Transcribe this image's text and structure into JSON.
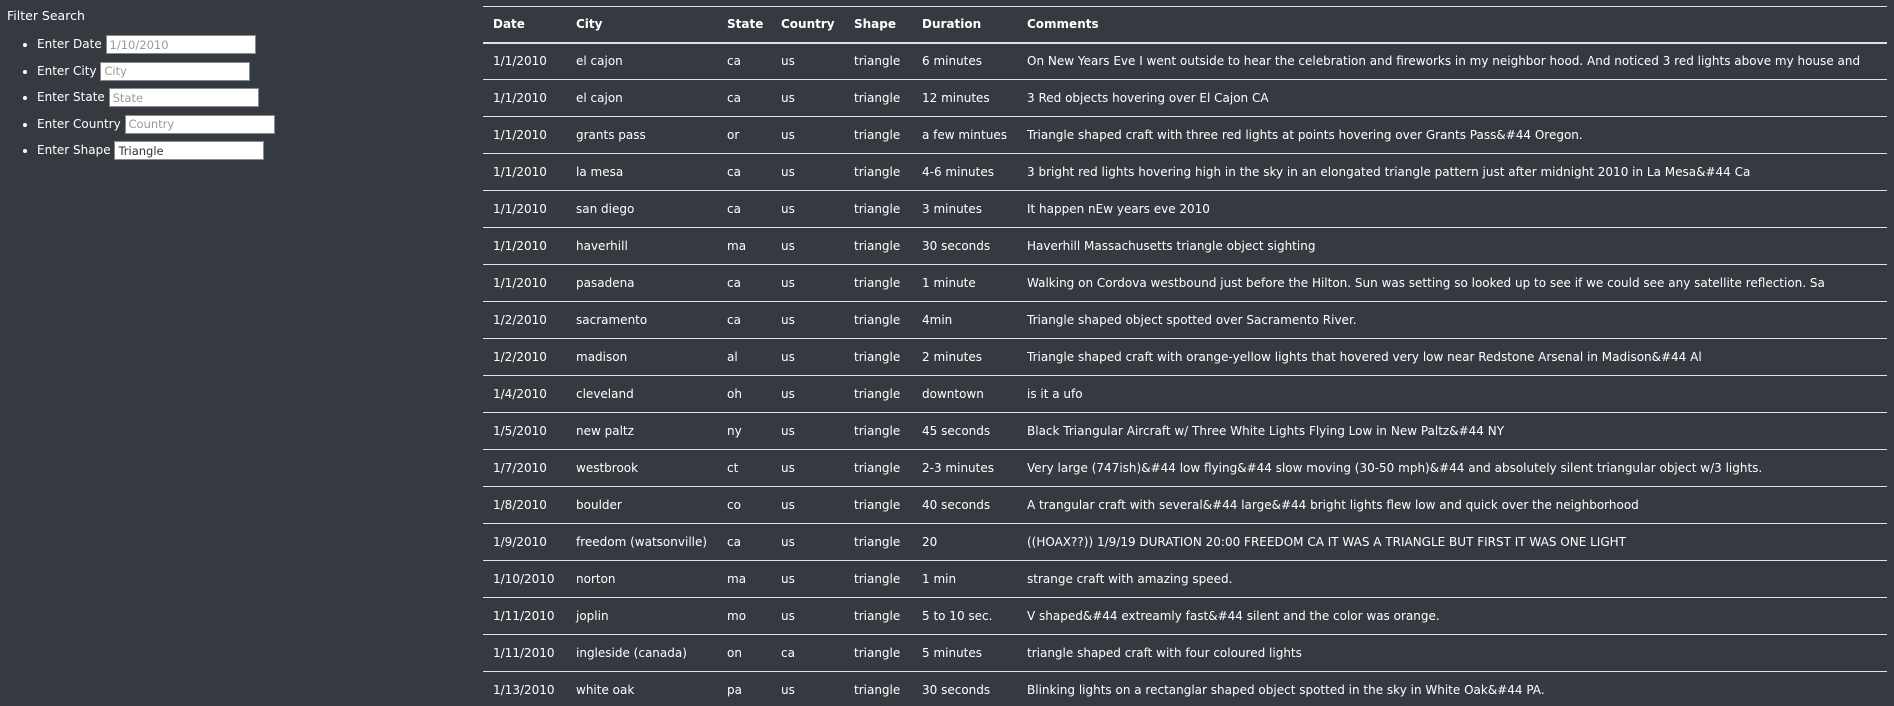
{
  "filters": {
    "title": "Filter Search",
    "items": [
      {
        "label": "Enter Date",
        "placeholder": "1/10/2010",
        "value": ""
      },
      {
        "label": "Enter City",
        "placeholder": "City",
        "value": ""
      },
      {
        "label": "Enter State",
        "placeholder": "State",
        "value": ""
      },
      {
        "label": "Enter Country",
        "placeholder": "Country",
        "value": ""
      },
      {
        "label": "Enter Shape",
        "placeholder": "",
        "value": "Triangle"
      }
    ]
  },
  "table": {
    "headers": [
      "Date",
      "City",
      "State",
      "Country",
      "Shape",
      "Duration",
      "Comments"
    ],
    "rows": [
      [
        "1/1/2010",
        "el cajon",
        "ca",
        "us",
        "triangle",
        "6 minutes",
        "On New Years Eve I went outside to hear the celebration and fireworks in my neighbor hood. And noticed 3 red lights above my house and"
      ],
      [
        "1/1/2010",
        "el cajon",
        "ca",
        "us",
        "triangle",
        "12 minutes",
        "3 Red objects hovering over El Cajon CA"
      ],
      [
        "1/1/2010",
        "grants pass",
        "or",
        "us",
        "triangle",
        "a few mintues",
        "Triangle shaped craft with three red lights at points hovering over Grants Pass&#44 Oregon."
      ],
      [
        "1/1/2010",
        "la mesa",
        "ca",
        "us",
        "triangle",
        "4-6 minutes",
        "3 bright red lights hovering high in the sky in an elongated triangle pattern just after midnight 2010 in La Mesa&#44 Ca"
      ],
      [
        "1/1/2010",
        "san diego",
        "ca",
        "us",
        "triangle",
        "3 minutes",
        "It happen nEw years eve 2010"
      ],
      [
        "1/1/2010",
        "haverhill",
        "ma",
        "us",
        "triangle",
        "30 seconds",
        "Haverhill Massachusetts triangle object sighting"
      ],
      [
        "1/1/2010",
        "pasadena",
        "ca",
        "us",
        "triangle",
        "1 minute",
        "Walking on Cordova westbound just before the Hilton. Sun was setting so looked up to see if we could see any satellite reflection. Sa"
      ],
      [
        "1/2/2010",
        "sacramento",
        "ca",
        "us",
        "triangle",
        "4min",
        "Triangle shaped object spotted over Sacramento River."
      ],
      [
        "1/2/2010",
        "madison",
        "al",
        "us",
        "triangle",
        "2 minutes",
        "Triangle shaped craft with orange-yellow lights that hovered very low near Redstone Arsenal in Madison&#44 Al"
      ],
      [
        "1/4/2010",
        "cleveland",
        "oh",
        "us",
        "triangle",
        "downtown",
        "is it a ufo"
      ],
      [
        "1/5/2010",
        "new paltz",
        "ny",
        "us",
        "triangle",
        "45 seconds",
        "Black Triangular Aircraft w/ Three White Lights Flying Low in New Paltz&#44 NY"
      ],
      [
        "1/7/2010",
        "westbrook",
        "ct",
        "us",
        "triangle",
        "2-3 minutes",
        "Very large (747ish)&#44 low flying&#44 slow moving (30-50 mph)&#44 and absolutely silent triangular object w/3 lights."
      ],
      [
        "1/8/2010",
        "boulder",
        "co",
        "us",
        "triangle",
        "40 seconds",
        "A trangular craft with several&#44 large&#44 bright lights flew low and quick over the neighborhood"
      ],
      [
        "1/9/2010",
        "freedom (watsonville)",
        "ca",
        "us",
        "triangle",
        "20",
        "((HOAX??)) 1/9/19 DURATION 20:00 FREEDOM CA IT WAS A TRIANGLE BUT FIRST IT WAS ONE LIGHT"
      ],
      [
        "1/10/2010",
        "norton",
        "ma",
        "us",
        "triangle",
        "1 min",
        "strange craft with amazing speed."
      ],
      [
        "1/11/2010",
        "joplin",
        "mo",
        "us",
        "triangle",
        "5 to 10 sec.",
        "V shaped&#44 extreamly fast&#44 silent and the color was orange."
      ],
      [
        "1/11/2010",
        "ingleside (canada)",
        "on",
        "ca",
        "triangle",
        "5 minutes",
        "triangle shaped craft with four coloured lights"
      ],
      [
        "1/13/2010",
        "white oak",
        "pa",
        "us",
        "triangle",
        "30 seconds",
        "Blinking lights on a rectanglar shaped object spotted in the sky in White Oak&#44 PA."
      ]
    ]
  }
}
